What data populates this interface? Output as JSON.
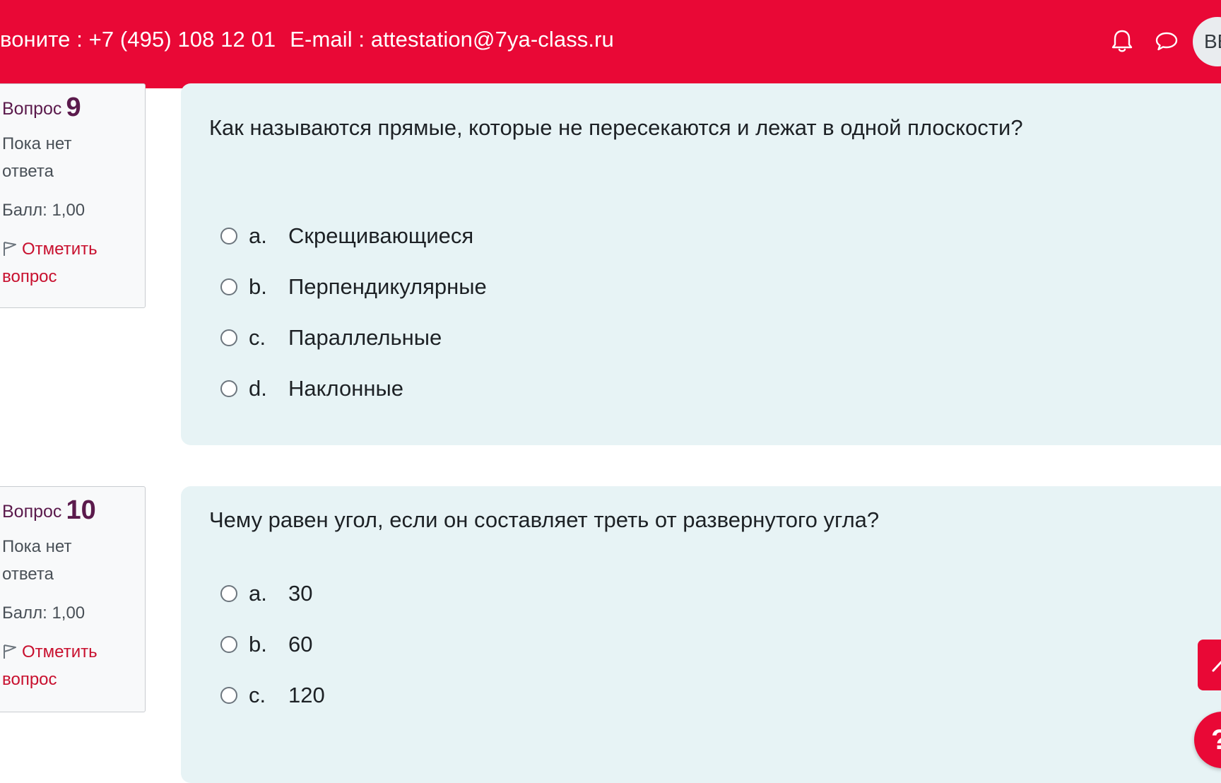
{
  "header": {
    "phone_text": "воните : +7 (495) 108 12 01",
    "email_text": "E-mail : attestation@7ya-class.ru",
    "avatar_initials": "ВЕ",
    "icons": [
      "bell-icon",
      "chat-bubble-icon"
    ],
    "color": "#e90836"
  },
  "questions": [
    {
      "label": "Вопрос",
      "number": "9",
      "state": "Пока нет ответа",
      "grade": "Балл: 1,00",
      "flag_label": "Отметить вопрос",
      "text": "Как называются прямые, которые не пересекаются и лежат в одной плоскости?",
      "answers": [
        {
          "letter": "a.",
          "text": "Скрещивающиеся"
        },
        {
          "letter": "b.",
          "text": "Перпендикулярные"
        },
        {
          "letter": "c.",
          "text": "Параллельные"
        },
        {
          "letter": "d.",
          "text": "Наклонные"
        }
      ]
    },
    {
      "label": "Вопрос",
      "number": "10",
      "state": "Пока нет ответа",
      "grade": "Балл: 1,00",
      "flag_label": "Отметить вопрос",
      "text": "Чему равен угол, если он составляет треть от развернутого угла?",
      "answers": [
        {
          "letter": "a.",
          "text": "30"
        },
        {
          "letter": "b.",
          "text": "60"
        },
        {
          "letter": "c.",
          "text": "120"
        }
      ]
    }
  ],
  "floating": {
    "help_label": "?"
  }
}
